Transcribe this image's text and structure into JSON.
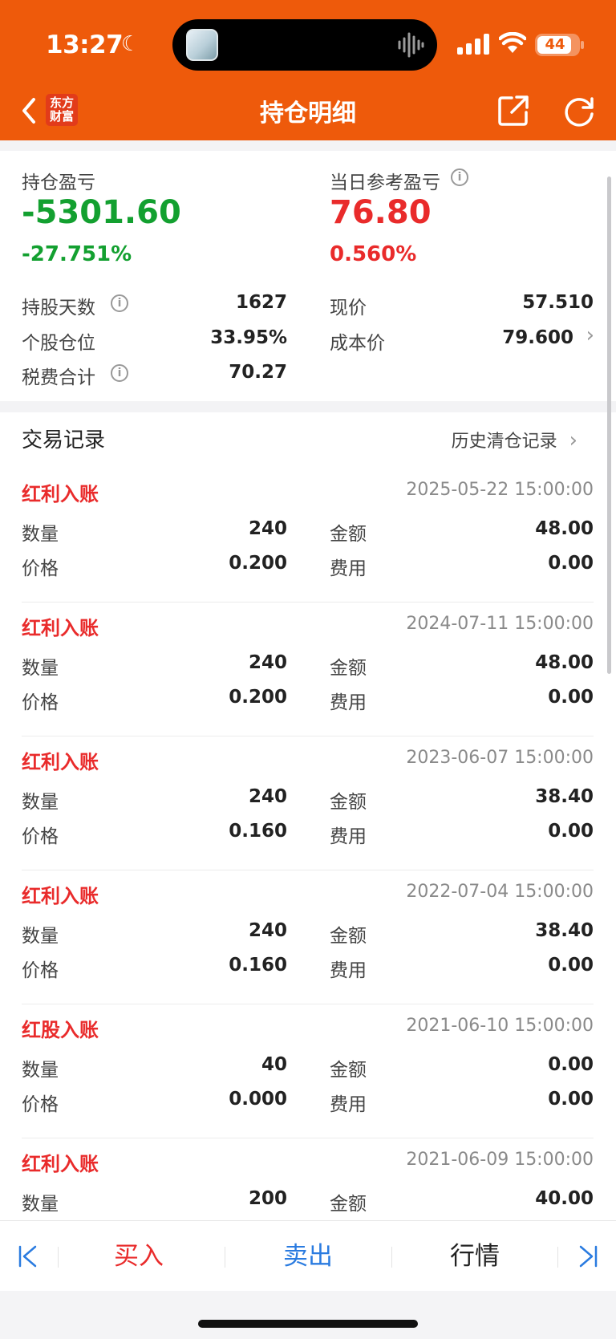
{
  "status_bar": {
    "time": "13:27",
    "battery": "44"
  },
  "header": {
    "title": "持仓明细",
    "logo_line1": "东方",
    "logo_line2": "财富"
  },
  "summary": {
    "position_pl_label": "持仓盈亏",
    "position_pl_value": "-5301.60",
    "position_pl_pct": "-27.751%",
    "daily_pl_label": "当日参考盈亏",
    "daily_pl_value": "76.80",
    "daily_pl_pct": "0.560%",
    "rows": [
      {
        "left_label": "持股天数",
        "left_value": "1627",
        "right_label": "现价",
        "right_value": "57.510"
      },
      {
        "left_label": "个股仓位",
        "left_value": "33.95%",
        "right_label": "成本价",
        "right_value": "79.600"
      },
      {
        "left_label": "税费合计",
        "left_value": "70.27"
      }
    ],
    "colors": {
      "loss": "#13a030",
      "gain": "#e92b2b"
    }
  },
  "records": {
    "title": "交易记录",
    "history_link": "历史清仓记录",
    "qty_label": "数量",
    "price_label": "价格",
    "amount_label": "金额",
    "fee_label": "费用",
    "items": [
      {
        "type": "红利入账",
        "datetime": "2025-05-22 15:00:00",
        "qty": "240",
        "price": "0.200",
        "amount": "48.00",
        "fee": "0.00"
      },
      {
        "type": "红利入账",
        "datetime": "2024-07-11 15:00:00",
        "qty": "240",
        "price": "0.200",
        "amount": "48.00",
        "fee": "0.00"
      },
      {
        "type": "红利入账",
        "datetime": "2023-06-07 15:00:00",
        "qty": "240",
        "price": "0.160",
        "amount": "38.40",
        "fee": "0.00"
      },
      {
        "type": "红利入账",
        "datetime": "2022-07-04 15:00:00",
        "qty": "240",
        "price": "0.160",
        "amount": "38.40",
        "fee": "0.00"
      },
      {
        "type": "红股入账",
        "datetime": "2021-06-10 15:00:00",
        "qty": "40",
        "price": "0.000",
        "amount": "0.00",
        "fee": "0.00"
      },
      {
        "type": "红利入账",
        "datetime": "2021-06-09 15:00:00",
        "qty": "200",
        "amount": "40.00"
      }
    ]
  },
  "bottom_bar": {
    "buy": "买入",
    "sell": "卖出",
    "quote": "行情",
    "buy_color": "#e92b2b",
    "sell_color": "#2a7be0"
  },
  "theme": {
    "header_bg": "#ee5a0b"
  }
}
